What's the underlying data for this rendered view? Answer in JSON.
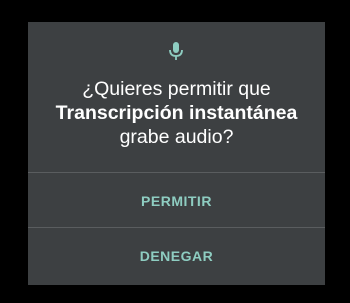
{
  "dialog": {
    "icon": "microphone-icon",
    "message_prefix": "¿Quieres permitir que",
    "app_name": "Transcripción instantánea",
    "message_suffix": "grabe audio?",
    "buttons": {
      "allow_label": "PERMITIR",
      "deny_label": "DENEGAR"
    }
  },
  "colors": {
    "dialog_background": "#3d4042",
    "accent": "#8ecdc1",
    "icon": "#8ecdc1",
    "divider": "#5a5d5f"
  }
}
